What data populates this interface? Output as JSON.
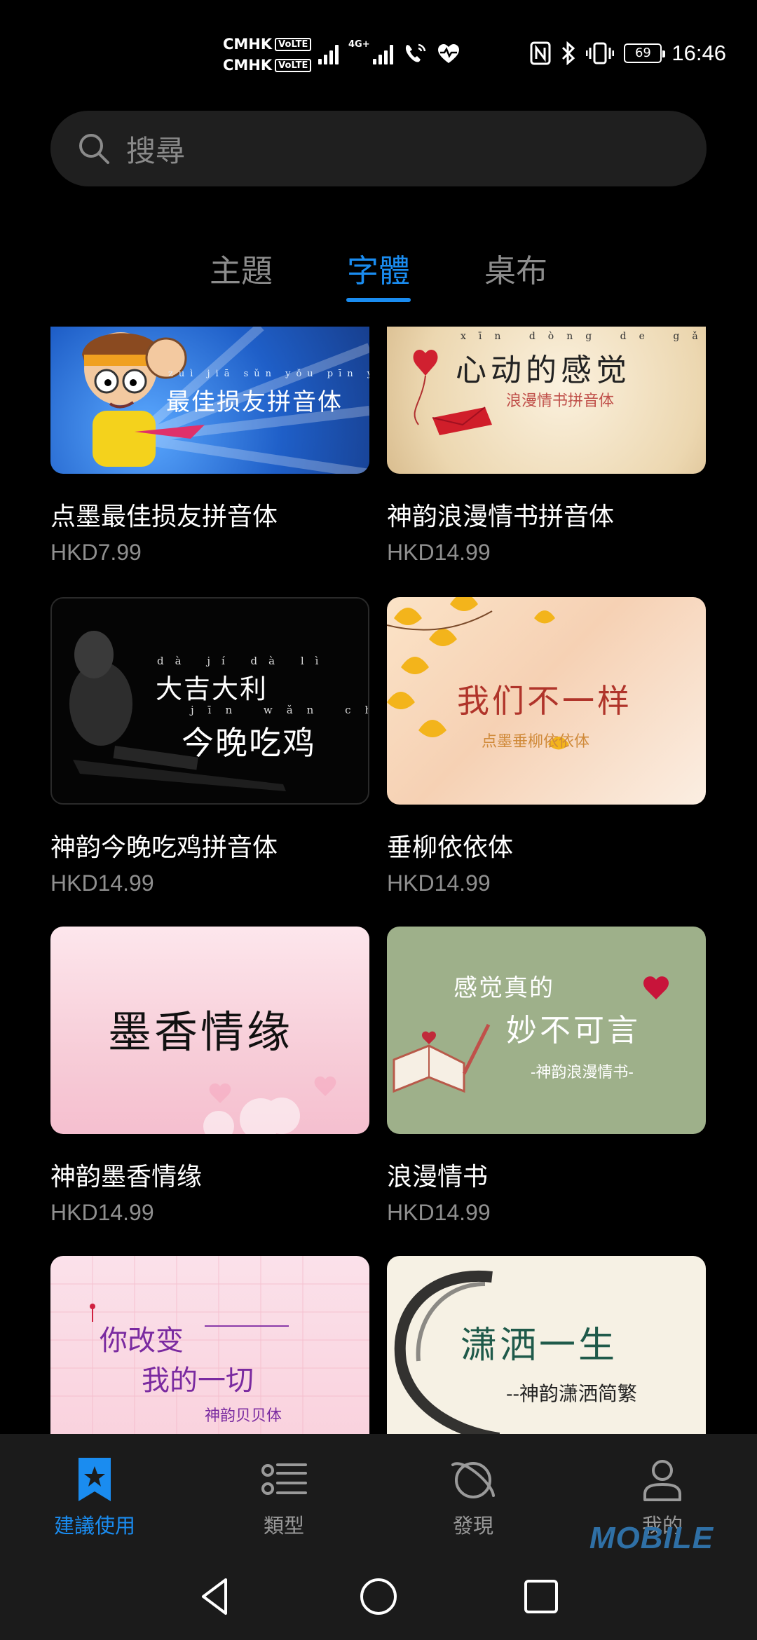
{
  "status_bar": {
    "carrier_1": "CMHK",
    "carrier_2": "CMHK",
    "volte": "VoLTE",
    "network": "4G+",
    "battery": "69",
    "time": "16:46"
  },
  "search": {
    "placeholder": "搜尋"
  },
  "tabs": [
    {
      "label": "主題",
      "active": false
    },
    {
      "label": "字體",
      "active": true
    },
    {
      "label": "桌布",
      "active": false
    }
  ],
  "fonts": [
    {
      "title": "点墨最佳损友拼音体",
      "price": "HKD7.99",
      "preview": "最佳损友拼音体",
      "preview_pinyin": "zuì jiā sǔn yǒu pīn yīn tǐ"
    },
    {
      "title": "神韵浪漫情书拼音体",
      "price": "HKD14.99",
      "preview": "心动的感觉",
      "preview_pinyin": "xīn dòng de gǎn jiào",
      "preview_sub": "浪漫情书拼音体"
    },
    {
      "title": "神韵今晚吃鸡拼音体",
      "price": "HKD14.99",
      "preview": "大吉大利",
      "preview_pinyin": "dà jí dà lì",
      "preview_2": "今晚吃鸡",
      "preview_pinyin_2": "jīn wǎn chī jī"
    },
    {
      "title": "垂柳依依体",
      "price": "HKD14.99",
      "preview": "我们不一样",
      "preview_sub": "点墨垂柳依依体"
    },
    {
      "title": "神韵墨香情缘",
      "price": "HKD14.99",
      "preview": "墨香情缘"
    },
    {
      "title": "浪漫情书",
      "price": "HKD14.99",
      "preview": "感觉真的",
      "preview_2": "妙不可言",
      "preview_sub": "-神韵浪漫情书-"
    },
    {
      "title": "",
      "price": "",
      "preview": "你改变",
      "preview_2": "我的一切",
      "preview_sub": "神韵贝贝体"
    },
    {
      "title": "",
      "price": "",
      "preview": "潇洒一生",
      "preview_sub": "--神韵潇洒简繁"
    }
  ],
  "bottom_nav": [
    {
      "label": "建議使用",
      "icon": "bookmark-star-icon",
      "active": true
    },
    {
      "label": "類型",
      "icon": "list-icon",
      "active": false
    },
    {
      "label": "發現",
      "icon": "planet-icon",
      "active": false
    },
    {
      "label": "我的",
      "icon": "person-icon",
      "active": false
    }
  ],
  "watermark": "MOBILE",
  "colors": {
    "accent": "#1a8cf0",
    "background": "#000000",
    "muted": "#8f8f8f"
  }
}
